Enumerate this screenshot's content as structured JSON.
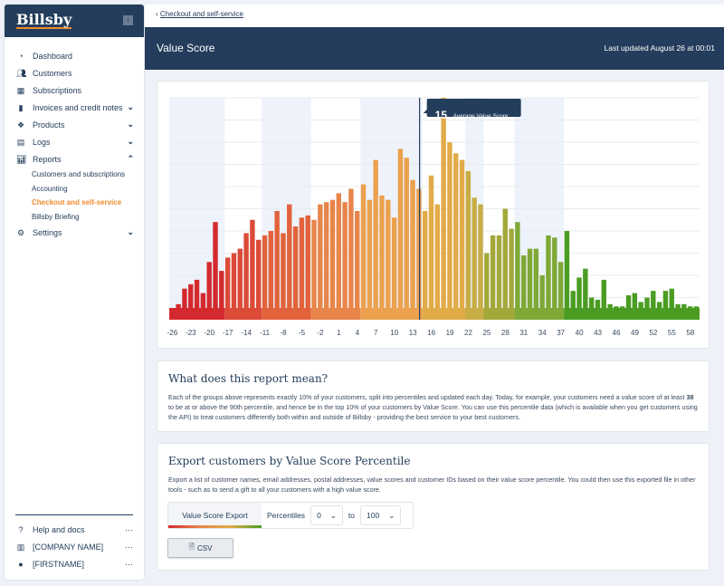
{
  "sidebar": {
    "logo": "Billsby",
    "collapse_icon": "chevron-left",
    "items": [
      {
        "label": "Dashboard",
        "icon": "gauge"
      },
      {
        "label": "Customers",
        "icon": "users"
      },
      {
        "label": "Subscriptions",
        "icon": "calendar"
      },
      {
        "label": "Invoices and credit notes",
        "icon": "invoice",
        "chevron": "down"
      },
      {
        "label": "Products",
        "icon": "boxes",
        "chevron": "down"
      },
      {
        "label": "Logs",
        "icon": "clipboard",
        "chevron": "down"
      },
      {
        "label": "Reports",
        "icon": "chart",
        "chevron": "up"
      }
    ],
    "report_subitems": [
      "Customers and subscriptions",
      "Accounting",
      "Checkout and self-service",
      "Billsby Briefing"
    ],
    "active_subitem": "Checkout and self-service",
    "settings": {
      "label": "Settings",
      "icon": "gears",
      "chevron": "down"
    },
    "bottom": [
      {
        "label": "Help and docs",
        "icon": "question"
      },
      {
        "label": "[COMPANY NAME]",
        "icon": "building"
      },
      {
        "label": "[FIRSTNAME]",
        "icon": "user"
      }
    ]
  },
  "breadcrumb": {
    "back": "Checkout and self-service"
  },
  "header": {
    "title": "Value Score",
    "updated": "Last updated August 26 at 00:01"
  },
  "colors": {
    "navy": "#243d5c",
    "accent": "#f08a2c",
    "groups": [
      "#d42a2e",
      "#dc4a38",
      "#e2623c",
      "#e8854a",
      "#eba14e",
      "#e1ab48",
      "#c6ad45",
      "#a3a83a",
      "#7fa837",
      "#4a9d22"
    ]
  },
  "chart_data": {
    "type": "bar",
    "x": [
      -26,
      -25,
      -24,
      -23,
      -22,
      -21,
      -20,
      -19,
      -18,
      -17,
      -16,
      -15,
      -14,
      -13,
      -12,
      -11,
      -10,
      -9,
      -8,
      -7,
      -6,
      -5,
      -4,
      -3,
      -2,
      -1,
      0,
      1,
      2,
      3,
      4,
      5,
      6,
      7,
      8,
      9,
      10,
      11,
      12,
      13,
      14,
      15,
      16,
      17,
      18,
      19,
      20,
      21,
      22,
      23,
      24,
      25,
      26,
      27,
      28,
      29,
      30,
      31,
      32,
      33,
      34,
      35,
      36,
      37,
      38,
      39,
      40,
      41,
      42,
      43,
      44,
      45,
      46,
      47,
      48,
      49,
      50,
      51,
      52,
      53,
      54,
      55,
      56,
      57,
      58,
      59
    ],
    "values": [
      5,
      7,
      14,
      16,
      18,
      12,
      26,
      44,
      22,
      28,
      30,
      32,
      39,
      45,
      36,
      38,
      40,
      49,
      39,
      52,
      42,
      46,
      47,
      45,
      52,
      53,
      54,
      57,
      53,
      59,
      49,
      61,
      54,
      72,
      56,
      54,
      46,
      77,
      73,
      63,
      59,
      49,
      65,
      52,
      100,
      80,
      75,
      72,
      67,
      55,
      52,
      30,
      38,
      38,
      50,
      41,
      44,
      29,
      32,
      32,
      20,
      38,
      37,
      26,
      40,
      13,
      19,
      23,
      10,
      9,
      18,
      7,
      6,
      6,
      11,
      12,
      8,
      10,
      13,
      8,
      13,
      14,
      7,
      7,
      6,
      6
    ],
    "x_tick_labels": [
      "-26",
      "-23",
      "-20",
      "-17",
      "-14",
      "-11",
      "-8",
      "-5",
      "-2",
      "1",
      "4",
      "7",
      "10",
      "13",
      "16",
      "19",
      "22",
      "25",
      "28",
      "31",
      "34",
      "37",
      "40",
      "43",
      "46",
      "49",
      "52",
      "55",
      "58"
    ],
    "percentile_group_starts": [
      -26,
      -17,
      -11,
      -3,
      5,
      15,
      22,
      25,
      30,
      38
    ],
    "average": {
      "value": 15,
      "label": "Average Value Score"
    },
    "grid": true,
    "legend": "none"
  },
  "report": {
    "title": "What does this report mean?",
    "p1": "Each of the groups above represents exactly 10% of your customers, split into percentiles and updated each day. Today, for example, your customers need a value score of at least ",
    "bold": "38",
    "p2": " to be at or above the 90th percentile, and hence be in the top 10% of your customers by Value Score. You can use this percentile data (which is available when you get customers using the API) to treat customers differently both within and outside of Billsby - providing the best service to your best customers."
  },
  "export": {
    "title": "Export customers by Value Score Percentile",
    "desc": "Export a list of customer names, email addresses, postal addresses, value scores and customer IDs based on their value score percentile. You could then use this exported file in other tools - such as to send a gift to all your customers with a high value score.",
    "tab": "Value Score Export",
    "percentiles_label": "Percentiles",
    "from": "0",
    "to_label": "to",
    "to": "100",
    "csv": "CSV"
  }
}
